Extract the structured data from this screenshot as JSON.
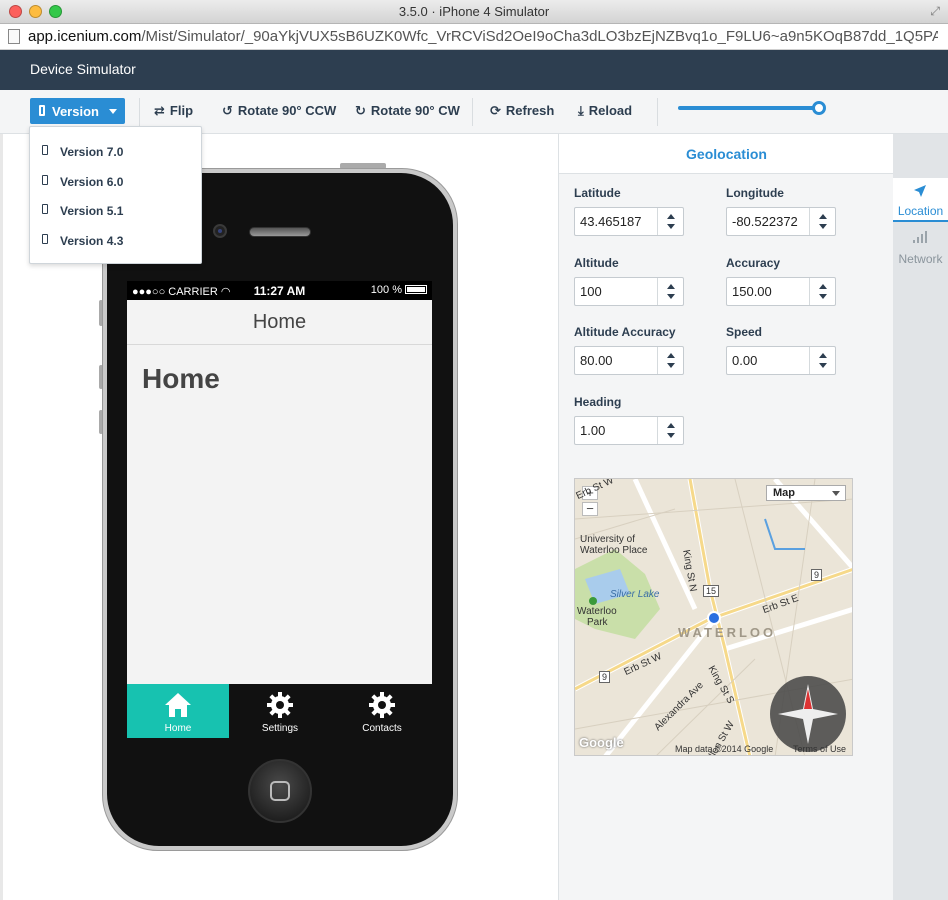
{
  "window": {
    "title": "3.5.0 · iPhone 4 Simulator",
    "url_host": "app.icenium.com",
    "url_path": "/Mist/Simulator/_90aYkjVUX5sB6UZK0Wfc_VrRCViSd2OeI9oCha3dLO3bzEjNZBvq1o_F9LU6~a9n5KOqB87dd_1Q5PA046q..."
  },
  "header": {
    "title": "Device Simulator"
  },
  "toolbar": {
    "version_label": "Version",
    "flip_label": "Flip",
    "rotate_ccw_label": "Rotate 90° CCW",
    "rotate_cw_label": "Rotate 90° CW",
    "refresh_label": "Refresh",
    "reload_label": "Reload",
    "zoom_level": 1.0
  },
  "version_menu": {
    "items": [
      {
        "label": "Version 7.0"
      },
      {
        "label": "Version 6.0"
      },
      {
        "label": "Version 5.1"
      },
      {
        "label": "Version 4.3"
      }
    ]
  },
  "device": {
    "status": {
      "carrier": "●●●○○ CARRIER",
      "time": "11:27 AM",
      "battery": "100 %"
    },
    "nav_title": "Home",
    "page_heading": "Home",
    "tabs": [
      {
        "label": "Home",
        "icon": "home-icon",
        "active": true
      },
      {
        "label": "Settings",
        "icon": "gear-icon",
        "active": false
      },
      {
        "label": "Contacts",
        "icon": "gear-icon",
        "active": false
      }
    ]
  },
  "geolocation": {
    "title": "Geolocation",
    "fields": {
      "latitude": {
        "label": "Latitude",
        "value": "43.465187"
      },
      "longitude": {
        "label": "Longitude",
        "value": "-80.522372"
      },
      "altitude": {
        "label": "Altitude",
        "value": "100"
      },
      "accuracy": {
        "label": "Accuracy",
        "value": "150.00"
      },
      "altitude_accuracy": {
        "label": "Altitude Accuracy",
        "value": "80.00"
      },
      "speed": {
        "label": "Speed",
        "value": "0.00"
      },
      "heading": {
        "label": "Heading",
        "value": "1.00"
      }
    },
    "map": {
      "type_select": "Map",
      "zoom_in": "+",
      "zoom_out": "−",
      "labels": {
        "place1": "University of",
        "place2": "Waterloo Place",
        "lake": "Silver Lake",
        "park1": "Waterloo",
        "park2": "Park",
        "city": "WATERLOO",
        "king_n": "King St N",
        "king_s": "King St S",
        "erb_e": "Erb St E",
        "erb_w": "Erb St W",
        "erb_w2": "Erb St W",
        "alexandra": "Alexandra Ave",
        "allen": "Allen St W",
        "route15": "15",
        "route9a": "9",
        "route9b": "9",
        "google": "Google",
        "copyright": "Map data ©2014 Google",
        "terms": "Terms of Use"
      }
    }
  },
  "side_tabs": [
    {
      "label": "Location",
      "icon": "location-arrow-icon",
      "active": true
    },
    {
      "label": "Network",
      "icon": "signal-bars-icon",
      "active": false
    }
  ],
  "colors": {
    "accent": "#2a8dd4",
    "header": "#2d3e50",
    "tab_active": "#17c2b0"
  }
}
